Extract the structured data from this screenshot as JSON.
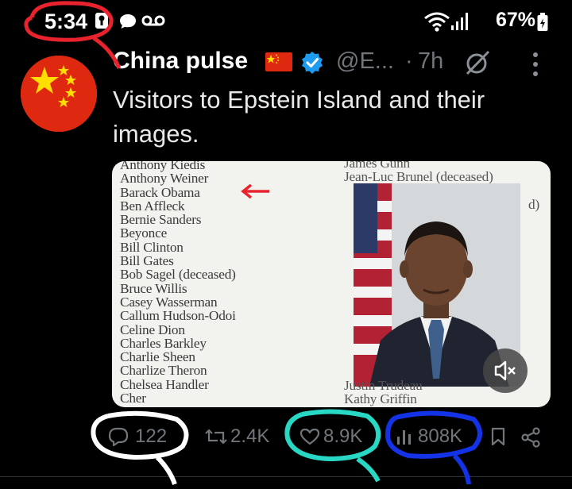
{
  "status_bar": {
    "time": "5:34",
    "battery": "67%",
    "icons": [
      "app-notification-icon",
      "chat-bubble-icon",
      "voicemail-icon",
      "wifi-icon",
      "signal-icon",
      "battery-icon"
    ]
  },
  "tweet": {
    "display_name": "China pulse",
    "handle": "@E...",
    "separator": "·",
    "time_ago": "7h",
    "text": "Visitors to Epstein Island and their images.",
    "media": {
      "list_left": [
        "Anthony Kiedis",
        "Anthony Weiner",
        "Barack Obama",
        "Ben Affleck",
        "Bernie Sanders",
        "Beyonce",
        "Bill Clinton",
        "Bill Gates",
        "Bob Sagel (deceased)",
        "Bruce Willis",
        "Casey Wasserman",
        "Callum Hudson-Odoi",
        "Celine Dion",
        "Charles Barkley",
        "Charlie Sheen",
        "Charlize Theron",
        "Chelsea Handler",
        "Cher"
      ],
      "list_right_top": [
        "James Gunn",
        "Jean-Luc Brunel (deceased)"
      ],
      "list_right_partial": "d)",
      "list_right_bottom": [
        "Justin Trudeau",
        "Kathy Griffin"
      ]
    },
    "actions": {
      "replies": "122",
      "reposts": "2.4K",
      "likes": "8.9K",
      "views": "808K"
    }
  },
  "colors": {
    "background": "#000000",
    "text": "#e7e9ea",
    "muted": "#71767b",
    "verified": "#1d9bf0",
    "annotation_red": "#e8232d",
    "annotation_white": "#ffffff",
    "annotation_cyan": "#28d7c4",
    "annotation_blue": "#1433e6"
  }
}
